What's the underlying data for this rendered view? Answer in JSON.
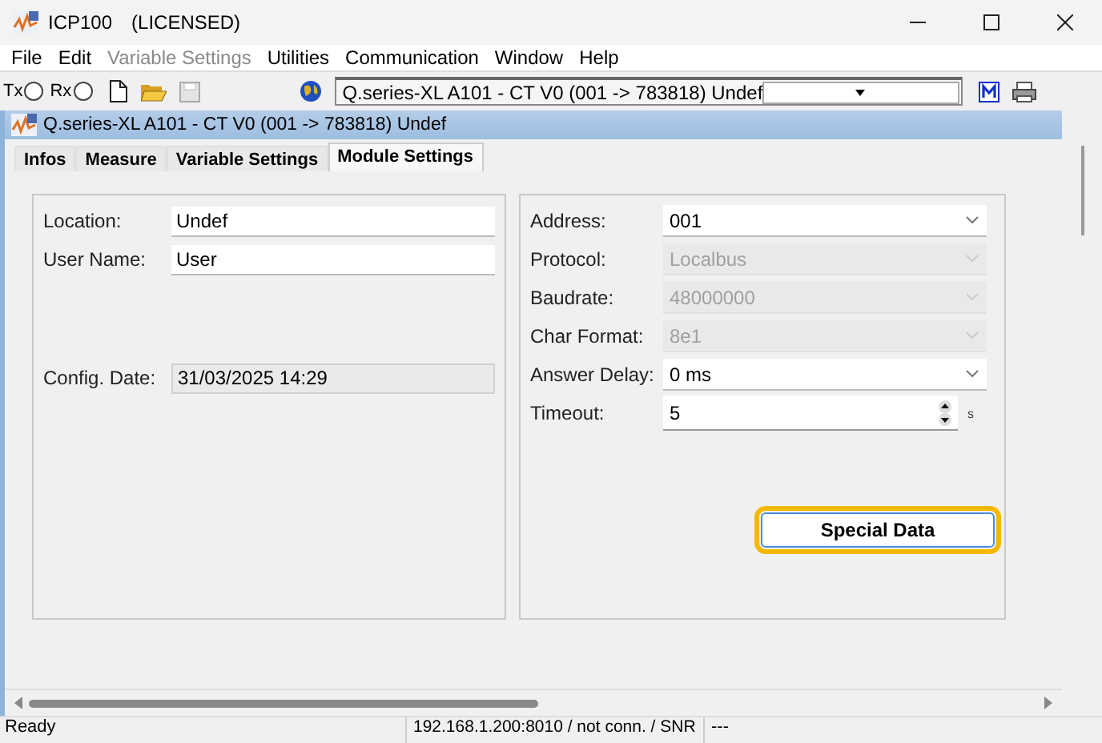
{
  "window": {
    "title": "ICP100",
    "license": "(LICENSED)"
  },
  "menu": [
    {
      "label": "File",
      "disabled": false
    },
    {
      "label": "Edit",
      "disabled": false
    },
    {
      "label": "Variable Settings",
      "disabled": true
    },
    {
      "label": "Utilities",
      "disabled": false
    },
    {
      "label": "Communication",
      "disabled": false
    },
    {
      "label": "Window",
      "disabled": false
    },
    {
      "label": "Help",
      "disabled": false
    }
  ],
  "toolbar": {
    "radios": [
      {
        "label": "Tx",
        "checked": false
      },
      {
        "label": "Rx",
        "checked": false
      }
    ],
    "device_combo": {
      "value": "Q.series-XL A101 - CT V0 (001 -> 783818) Undef"
    }
  },
  "child_window": {
    "title": "Q.series-XL A101 - CT V0 (001 -> 783818) Undef"
  },
  "tabs": [
    {
      "label": "Infos",
      "selected": false
    },
    {
      "label": "Measure",
      "selected": false
    },
    {
      "label": "Variable Settings",
      "selected": false
    },
    {
      "label": "Module Settings",
      "selected": true
    }
  ],
  "left_fields": [
    {
      "label": "Location:",
      "value": "Undef",
      "disabled": false
    },
    {
      "label": "User Name:",
      "value": "User",
      "disabled": false
    },
    {
      "label": "Config. Date:",
      "value": "31/03/2025 14:29",
      "disabled": true
    }
  ],
  "right_fields": [
    {
      "kind": "combo",
      "label": "Address:",
      "value": "001",
      "disabled": false
    },
    {
      "kind": "combo",
      "label": "Protocol:",
      "value": "Localbus",
      "disabled": true
    },
    {
      "kind": "combo",
      "label": "Baudrate:",
      "value": "48000000",
      "disabled": true
    },
    {
      "kind": "combo",
      "label": "Char Format:",
      "value": "8e1",
      "disabled": true
    },
    {
      "kind": "combo",
      "label": "Answer Delay:",
      "value": "0 ms",
      "disabled": false
    },
    {
      "kind": "spin",
      "label": "Timeout:",
      "value": "5",
      "unit": "s"
    }
  ],
  "special_button": {
    "label": "Special Data",
    "highlighted": true
  },
  "status_bar": [
    "Ready",
    "192.168.1.200:8010 / not conn. / SNR",
    "---"
  ]
}
